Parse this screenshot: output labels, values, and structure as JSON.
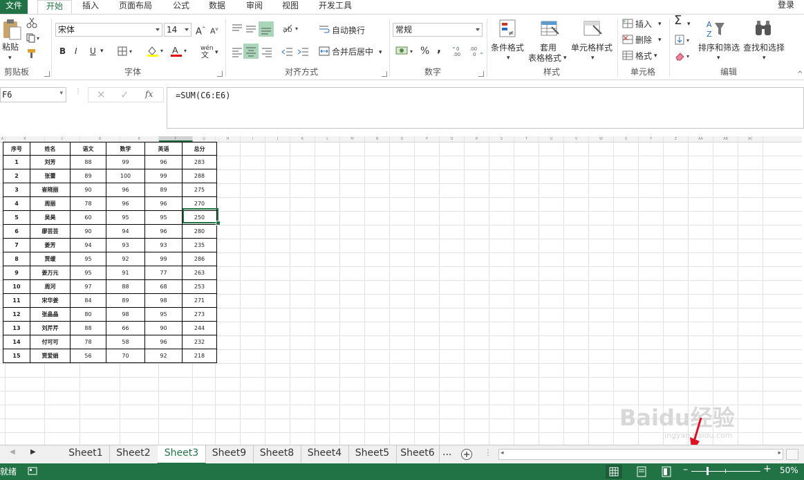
{
  "ribbon_tabs": [
    "文件",
    "开始",
    "插入",
    "页面布局",
    "公式",
    "数据",
    "审阅",
    "视图",
    "开发工具"
  ],
  "active_tab": "开始",
  "login": "登录",
  "clipboard": {
    "paste": "粘贴",
    "group": "剪贴板"
  },
  "font": {
    "name": "宋体",
    "size": "14",
    "group": "字体",
    "bold": "B",
    "italic": "I",
    "underline": "U",
    "phonetic": "wén"
  },
  "alignment": {
    "wrap": "自动换行",
    "merge": "合并后居中",
    "group": "对齐方式"
  },
  "number": {
    "format": "常规",
    "group": "数字",
    "percent": "%",
    "comma": ","
  },
  "styles": {
    "conditional": "条件格式",
    "table_line1": "套用",
    "table_line2": "表格格式",
    "cell_styles": "单元格样式",
    "group": "样式"
  },
  "cells": {
    "insert": "插入",
    "delete": "删除",
    "format": "格式",
    "group": "单元格"
  },
  "editing": {
    "sort": "排序和筛选",
    "find": "查找和选择",
    "group": "编辑"
  },
  "formula_bar": {
    "name_box": "F6",
    "fx": "fx",
    "formula": "=SUM(C6:E6)"
  },
  "columns": [
    "A",
    "B",
    "C",
    "D",
    "E",
    "F",
    "G",
    "H",
    "I",
    "J",
    "K",
    "L",
    "M",
    "N",
    "O",
    "P",
    "Q",
    "R",
    "S",
    "T",
    "U",
    "V",
    "W",
    "X",
    "Y",
    "Z",
    "AA",
    "AB",
    "AC"
  ],
  "table": {
    "headers": [
      "序号",
      "姓名",
      "语文",
      "数学",
      "英语",
      "总分"
    ],
    "rows": [
      [
        "1",
        "刘芳",
        "88",
        "99",
        "96",
        "283"
      ],
      [
        "2",
        "张蕾",
        "89",
        "100",
        "99",
        "288"
      ],
      [
        "3",
        "崔晓丽",
        "90",
        "96",
        "89",
        "275"
      ],
      [
        "4",
        "周丽",
        "78",
        "96",
        "96",
        "270"
      ],
      [
        "5",
        "吴昊",
        "60",
        "95",
        "95",
        "250"
      ],
      [
        "6",
        "廖芸芸",
        "90",
        "94",
        "96",
        "280"
      ],
      [
        "7",
        "姜芳",
        "94",
        "93",
        "93",
        "235"
      ],
      [
        "8",
        "贾缓",
        "95",
        "92",
        "99",
        "286"
      ],
      [
        "9",
        "姜万元",
        "95",
        "91",
        "77",
        "263"
      ],
      [
        "10",
        "周河",
        "97",
        "88",
        "68",
        "253"
      ],
      [
        "11",
        "宋华姜",
        "84",
        "89",
        "98",
        "271"
      ],
      [
        "12",
        "张晶晶",
        "80",
        "98",
        "95",
        "273"
      ],
      [
        "13",
        "刘芹芹",
        "88",
        "66",
        "90",
        "244"
      ],
      [
        "14",
        "付可可",
        "78",
        "58",
        "96",
        "232"
      ],
      [
        "15",
        "贾爱娟",
        "56",
        "70",
        "92",
        "218"
      ]
    ]
  },
  "sheets": [
    "Sheet1",
    "Sheet2",
    "Sheet3",
    "Sheet9",
    "Sheet8",
    "Sheet4",
    "Sheet5",
    "Sheet6"
  ],
  "active_sheet": "Sheet3",
  "status": {
    "ready": "就绪",
    "zoom": "50%"
  },
  "watermark": "Baidu经验 jingyan.baidu.com",
  "colors": {
    "excel_green": "#217346"
  }
}
